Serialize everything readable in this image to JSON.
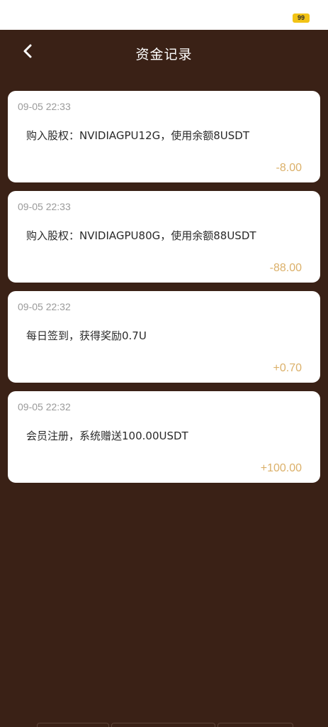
{
  "status_bar": {
    "battery": "99"
  },
  "header": {
    "title": "资金记录",
    "back_icon": "chevron-left-icon"
  },
  "records": [
    {
      "time": "09-05 22:33",
      "description": "购入股权：NVIDIAGPU12G，使用余额8USDT",
      "amount": "-8.00"
    },
    {
      "time": "09-05 22:33",
      "description": "购入股权：NVIDIAGPU80G，使用余额88USDT",
      "amount": "-88.00"
    },
    {
      "time": "09-05 22:32",
      "description": "每日签到，获得奖励0.7U",
      "amount": "+0.70"
    },
    {
      "time": "09-05 22:32",
      "description": "会员注册，系统赠送100.00USDT",
      "amount": "+100.00"
    }
  ],
  "colors": {
    "background": "#3a2116",
    "card": "#ffffff",
    "amount": "#dbb069",
    "battery": "#f2c315"
  }
}
